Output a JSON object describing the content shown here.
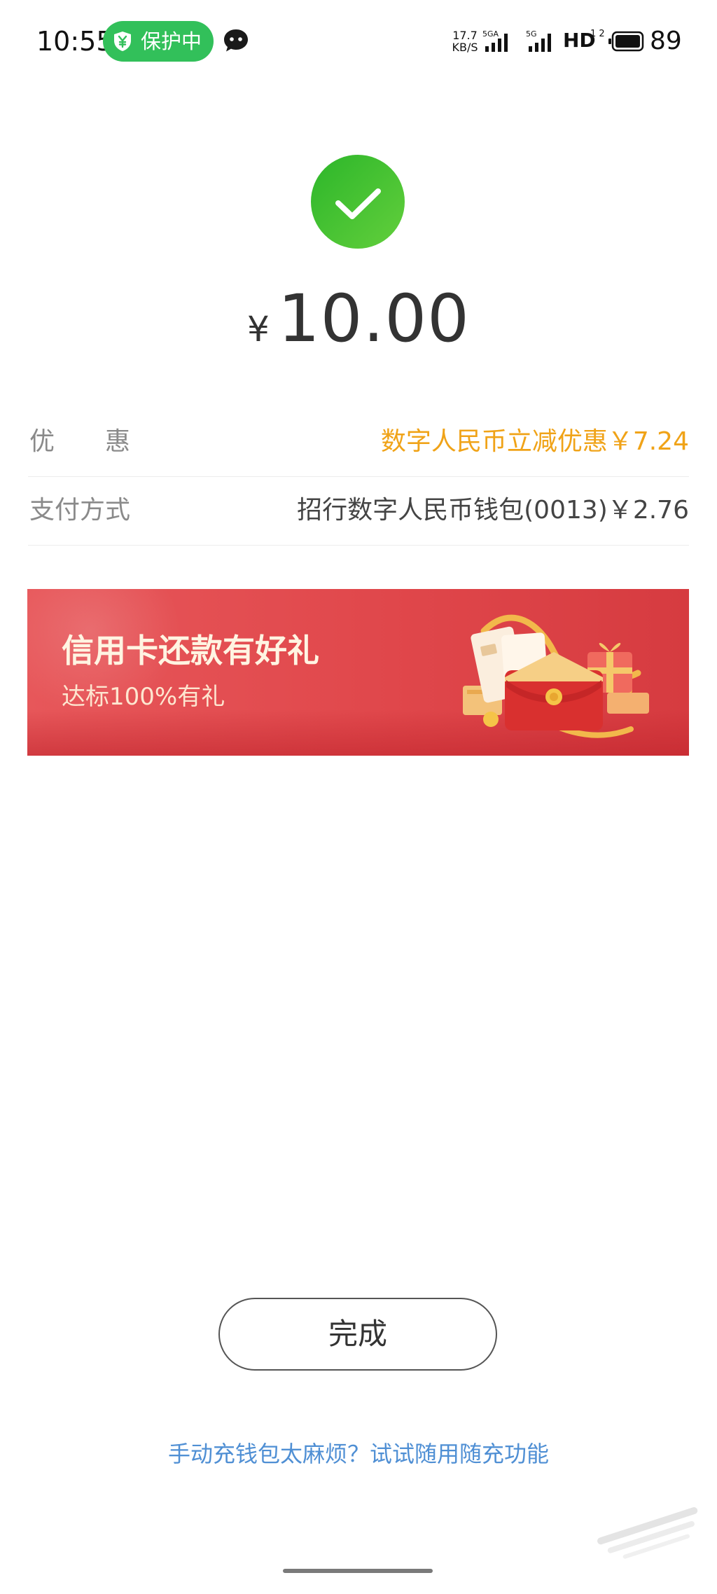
{
  "status_bar": {
    "time": "10:55",
    "protection_badge": "保护中",
    "network_speed_value": "17.7",
    "network_speed_unit": "KB/S",
    "signal_1_label": "5GA",
    "signal_2_label": "5G",
    "hd_label": "HD",
    "hd_sub_label": "1 2",
    "battery_percent": "89"
  },
  "payment": {
    "currency_symbol": "¥",
    "amount": "10.00"
  },
  "details": {
    "discount_label": "优　　惠",
    "discount_value": "数字人民币立减优惠￥7.24",
    "method_label": "支付方式",
    "method_value": "招行数字人民币钱包(0013)￥2.76"
  },
  "promo": {
    "title": "信用卡还款有好礼",
    "subtitle": "达标100%有礼"
  },
  "actions": {
    "done_label": "完成",
    "auto_topup_link": "手动充钱包太麻烦？试试随用随充功能"
  },
  "colors": {
    "success_green": "#3cc13b",
    "discount_orange": "#f0a318",
    "link_blue": "#4f8fd4",
    "banner_red": "#e0474b",
    "protection_green": "#32c05a"
  },
  "icons": {
    "success": "checkmark-circle-icon",
    "shield": "shield-yuan-icon",
    "chat": "chat-bubble-icon",
    "signal": "signal-bars-icon",
    "battery": "battery-icon",
    "gift": "gift-envelope-illustration"
  }
}
